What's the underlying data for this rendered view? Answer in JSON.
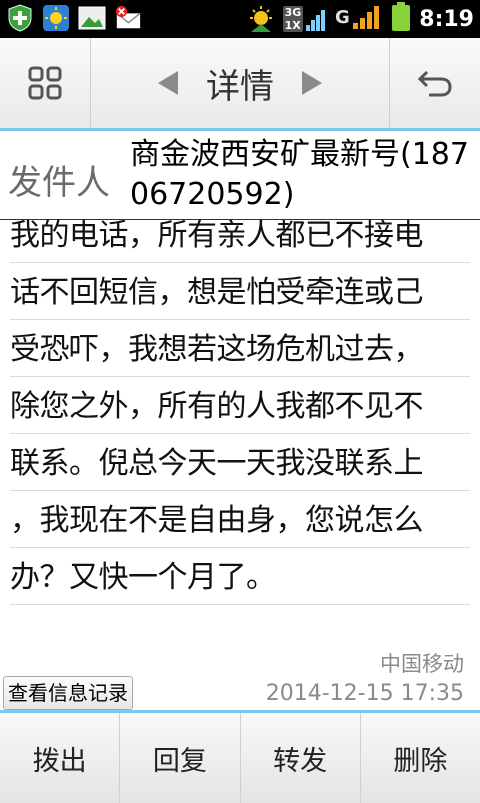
{
  "status_bar": {
    "time": "8:19",
    "network_type_top": "3G",
    "network_type_bottom": "1X",
    "icons": [
      "shield-plus-icon",
      "weather-sun-icon",
      "gallery-icon",
      "message-error-icon",
      "sun-clock-icon",
      "network-3g-icon",
      "signal-icon",
      "battery-icon"
    ]
  },
  "toolbar": {
    "title": "详情",
    "left_icon": "menu-grid-icon",
    "prev_icon": "arrow-left-icon",
    "next_icon": "arrow-right-icon",
    "back_icon": "undo-icon"
  },
  "message": {
    "sender_label": "发件人",
    "sender_value": "商金波西安矿最新号(18706720592)",
    "lines": [
      "我的电话，所有亲人都已不接电",
      "话不回短信，想是怕受牵连或己",
      "受恐吓，我想若这场危机过去，",
      "除您之外，所有的人我都不见不",
      "联系。倪总今天一天我没联系上",
      "，我现在不是自由身，您说怎么",
      "办？又快一个月了。"
    ],
    "carrier": "中国移动",
    "timestamp": "2014-12-15 17:35",
    "history_button": "查看信息记录"
  },
  "bottom_bar": {
    "buttons": [
      "拨出",
      "回复",
      "转发",
      "删除"
    ]
  },
  "colors": {
    "accent": "#7fc6e8",
    "status_bar": "#000000"
  }
}
